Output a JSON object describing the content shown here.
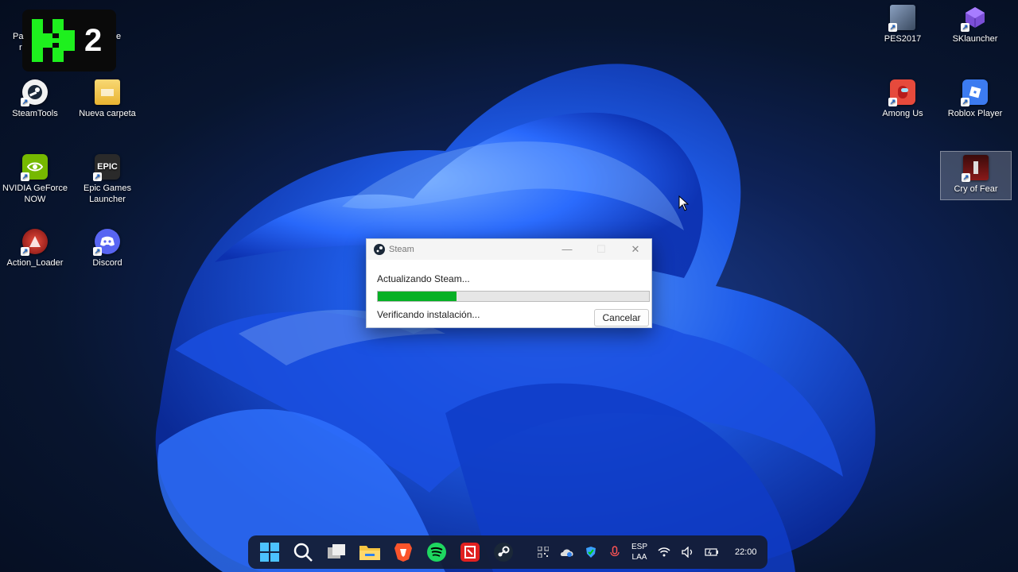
{
  "overlay": {
    "logo_number": "2"
  },
  "desktop": {
    "left_icons": [
      {
        "label": "SteamTools",
        "icon": "steamtools-icon",
        "color": "#f2f2f2"
      },
      {
        "label": "Nueva carpeta",
        "icon": "folder-icon",
        "color": "#f5c84c"
      },
      {
        "label": "NVIDIA GeForce NOW",
        "icon": "nvidia-icon",
        "color": "#76b900"
      },
      {
        "label": "Epic Games Launcher",
        "icon": "epic-games-icon",
        "color": "#2a2a2a"
      },
      {
        "label": "Action_Loader",
        "icon": "action-loader-icon",
        "color": "#c0392b"
      },
      {
        "label": "Discord",
        "icon": "discord-icon",
        "color": "#5865f2"
      }
    ],
    "partial_labels": [
      "Pa",
      "r",
      "e"
    ],
    "right_icons": [
      {
        "label": "PES2017",
        "icon": "pes2017-icon",
        "color": "#5a6a80"
      },
      {
        "label": "SKlauncher",
        "icon": "sklauncher-icon",
        "color": "#7b4fd6"
      },
      {
        "label": "Among Us",
        "icon": "among-us-icon",
        "color": "#d32f2f"
      },
      {
        "label": "Roblox Player",
        "icon": "roblox-icon",
        "color": "#3c7bf0"
      },
      {
        "label": "Cry of Fear",
        "icon": "cry-of-fear-icon",
        "color": "#5a1010"
      }
    ],
    "epic_icon_text": "EPIC"
  },
  "dialog": {
    "title": "Steam",
    "status": "Actualizando Steam...",
    "progress": 0.29,
    "substatus": "Verificando instalación...",
    "cancel_label": "Cancelar",
    "accent": "#06b025"
  },
  "taskbar": {
    "apps": [
      "start-icon",
      "search-icon",
      "task-view-icon",
      "file-explorer-icon",
      "brave-icon",
      "spotify-icon",
      "red-app-icon",
      "steam-icon"
    ],
    "tray": [
      "qr-icon",
      "onedrive-icon",
      "defender-icon",
      "microphone-icon"
    ],
    "lang_top": "ESP",
    "lang_bottom": "LAA",
    "clock": "22:00"
  }
}
